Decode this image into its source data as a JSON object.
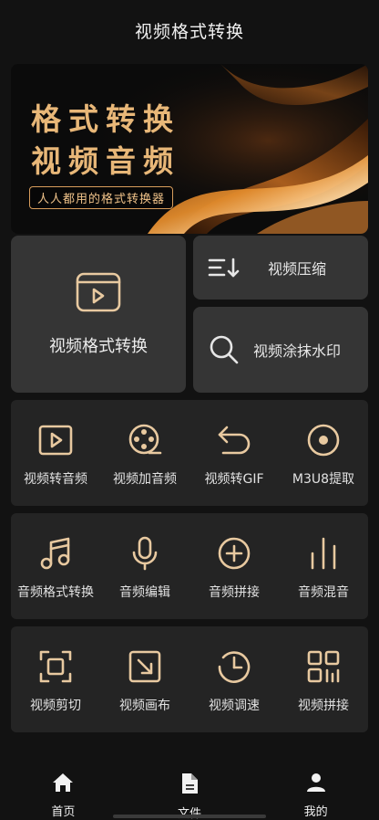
{
  "header": {
    "title": "视频格式转换"
  },
  "banner": {
    "line1": "格式转换",
    "line2": "视频音频",
    "tagline": "人人都用的格式转换器"
  },
  "feature": {
    "main_label": "视频格式转换",
    "compress_label": "视频压缩",
    "watermark_label": "视频涂抹水印"
  },
  "tools": {
    "row1": [
      "视频转音频",
      "视频加音频",
      "视频转GIF",
      "M3U8提取"
    ],
    "row2": [
      "音频格式转换",
      "音频编辑",
      "音频拼接",
      "音频混音"
    ],
    "row3": [
      "视频剪切",
      "视频画布",
      "视频调速",
      "视频拼接"
    ]
  },
  "nav": {
    "home": "首页",
    "files": "文件",
    "mine": "我的"
  },
  "colors": {
    "accent": "#e8c9a0",
    "banner_text": "#e8b778",
    "card": "#353535",
    "panel": "#242424",
    "background": "#121212"
  }
}
